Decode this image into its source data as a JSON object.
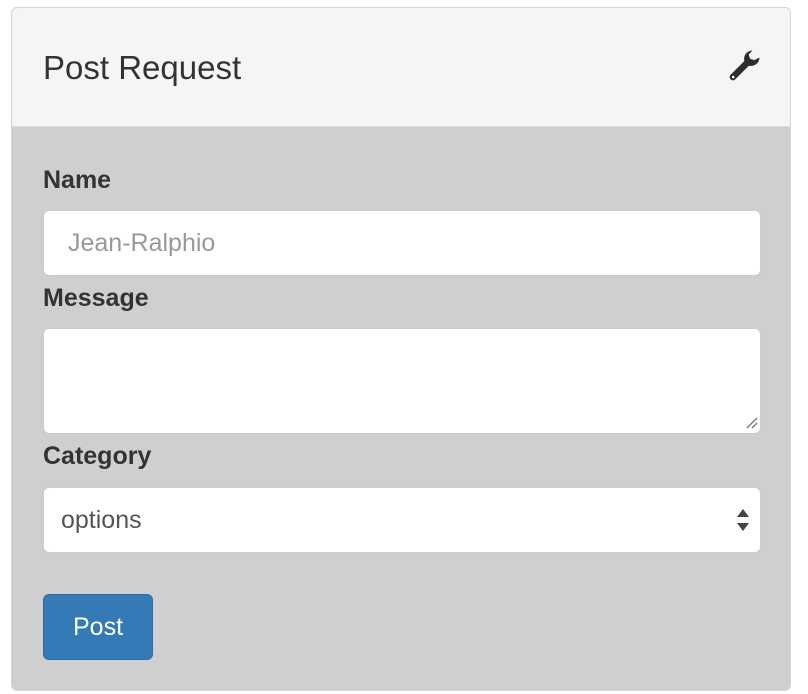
{
  "panel": {
    "title": "Post Request",
    "settings_icon": "wrench-icon"
  },
  "form": {
    "name_label": "Name",
    "name_placeholder": "Jean-Ralphio",
    "name_value": "",
    "message_label": "Message",
    "message_value": "",
    "category_label": "Category",
    "category_selected": "options",
    "submit_label": "Post"
  },
  "colors": {
    "header_bg": "#f5f5f5",
    "panel_bg": "#cfcfcf",
    "primary": "#337ab7"
  }
}
